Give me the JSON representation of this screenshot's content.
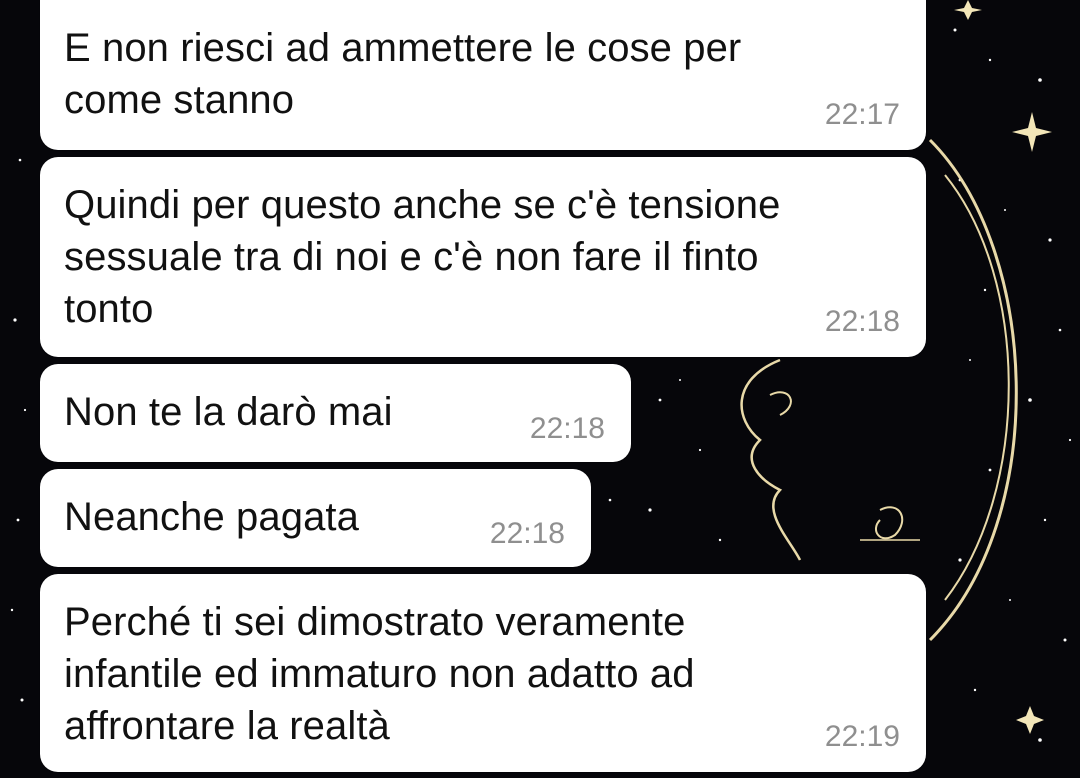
{
  "colors": {
    "wallpaper": "#06060a",
    "bubble": "#ffffff",
    "text": "#111111",
    "timestamp": "#8f8f8f",
    "gold": "#e8d9a8"
  },
  "wallpaper": {
    "icon": "moon-face-icon"
  },
  "messages": [
    {
      "text": "E non riesci ad ammettere le cose per\ncome stanno",
      "time": "22:17"
    },
    {
      "text": "Quindi per questo anche se c'è tensione\nsessuale tra di noi e c'è non fare il finto\ntonto",
      "time": "22:18"
    },
    {
      "text": "Non te la darò mai",
      "time": "22:18"
    },
    {
      "text": "Neanche pagata",
      "time": "22:18"
    },
    {
      "text": "Perché ti sei dimostrato veramente\ninfantile ed immaturo non adatto ad\naffrontare la realtà",
      "time": "22:19"
    }
  ]
}
